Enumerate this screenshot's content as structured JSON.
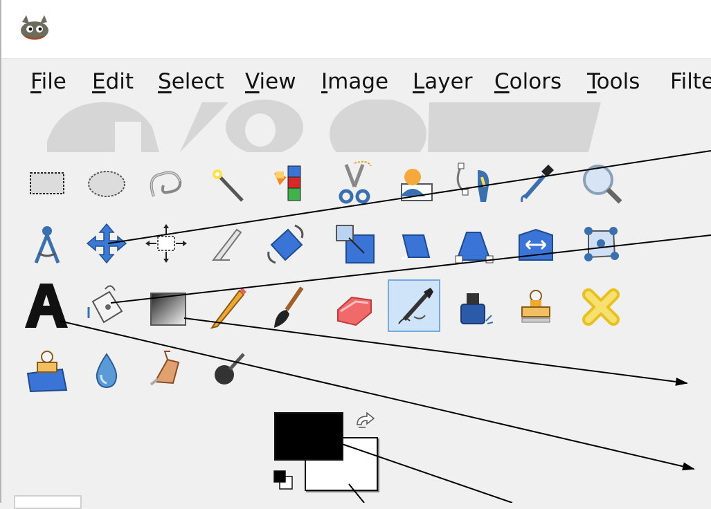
{
  "menu": {
    "file": {
      "accel": "F",
      "rest": "ile"
    },
    "edit": {
      "accel": "E",
      "rest": "dit"
    },
    "select": {
      "accel": "S",
      "rest": "elect"
    },
    "view": {
      "accel": "V",
      "rest": "iew"
    },
    "image": {
      "accel": "I",
      "rest": "mage"
    },
    "layer": {
      "accel": "L",
      "rest": "ayer"
    },
    "colors": {
      "accel": "C",
      "rest": "olors"
    },
    "tools": {
      "accel": "T",
      "rest": "ools"
    },
    "filters": {
      "text": "Filte"
    }
  },
  "toolbox": {
    "selected_tool": "ink-tool",
    "rows": [
      [
        "rect-select-icon",
        "ellipse-select-icon",
        "free-select-icon",
        "fuzzy-select-icon",
        "color-select-icon",
        "scissors-select-icon",
        "foreground-select-icon",
        "paths-icon",
        "color-picker-icon",
        "zoom-icon"
      ],
      [
        "measure-icon",
        "move-icon",
        "align-icon",
        "crop-icon",
        "rotate-icon",
        "scale-icon",
        "shear-icon",
        "perspective-icon",
        "flip-icon",
        "cage-transform-icon"
      ],
      [
        "text-icon",
        "bucket-fill-icon",
        "blend-icon",
        "pencil-icon",
        "paintbrush-icon",
        "eraser-icon",
        "airbrush-icon",
        "ink-icon",
        "clone-icon",
        "heal-icon"
      ],
      [
        "perspective-clone-icon",
        "blur-sharpen-icon",
        "smudge-icon",
        "dodge-burn-icon"
      ]
    ]
  },
  "colors": {
    "foreground": "#000000",
    "background": "#ffffff",
    "selection_highlight": "#cfe4f8",
    "selection_border": "#74a9df"
  }
}
